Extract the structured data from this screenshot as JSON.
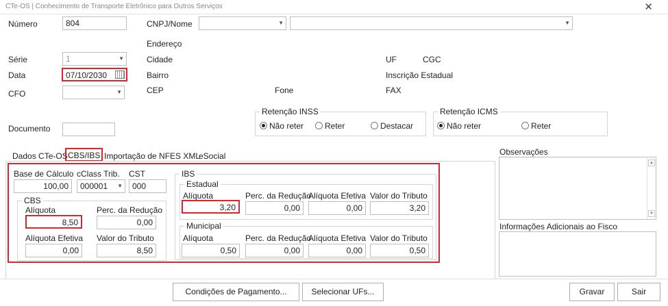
{
  "window": {
    "title": "CTe-OS | Conhecimento de Transporte Eletrônico para Outros Serviços",
    "close": "✕"
  },
  "header": {
    "numero_label": "Número",
    "numero_value": "804",
    "cnpj_label": "CNPJ/Nome",
    "endereco_label": "Endereço",
    "serie_label": "Série",
    "serie_value": "1",
    "cidade_label": "Cidade",
    "uf_label": "UF",
    "cgc_label": "CGC",
    "data_label": "Data",
    "data_value": "07/10/2030",
    "bairro_label": "Bairro",
    "ie_label": "Inscrição Estadual",
    "cfo_label": "CFO",
    "cep_label": "CEP",
    "fone_label": "Fone",
    "fax_label": "FAX",
    "documento_label": "Documento"
  },
  "retencao_inss": {
    "caption": "Retenção INSS",
    "options": [
      "Não reter",
      "Reter",
      "Destacar"
    ],
    "selected": "Não reter"
  },
  "retencao_icms": {
    "caption": "Retenção ICMS",
    "options": [
      "Não reter",
      "Reter"
    ],
    "selected": "Não reter"
  },
  "tabs": [
    {
      "label": "Dados CTe-OS",
      "active": false
    },
    {
      "label": "CBS/IBS",
      "active": true
    },
    {
      "label": "Importação de NFES XML",
      "active": false
    },
    {
      "label": "eSocial",
      "active": false
    }
  ],
  "cbs_ibs": {
    "base_calculo_label": "Base de Cálculo",
    "base_calculo_value": "100,00",
    "cclass_label": "cClass Trib.",
    "cclass_value": "000001",
    "cst_label": "CST",
    "cst_value": "000",
    "cbs": {
      "caption": "CBS",
      "aliquota_label": "Alíquota",
      "aliquota_value": "8,50",
      "perc_reducao_label": "Perc. da Redução",
      "perc_reducao_value": "0,00",
      "aliquota_efetiva_label": "Alíquota Efetiva",
      "aliquota_efetiva_value": "0,00",
      "valor_tributo_label": "Valor do Tributo",
      "valor_tributo_value": "8,50"
    },
    "ibs": {
      "caption": "IBS",
      "estadual": {
        "caption": "Estadual",
        "aliquota_label": "Alíquota",
        "aliquota_value": "3,20",
        "perc_reducao_label": "Perc. da Redução",
        "perc_reducao_value": "0,00",
        "aliquota_efetiva_label": "Alíquota Efetiva",
        "aliquota_efetiva_value": "0,00",
        "valor_tributo_label": "Valor do Tributo",
        "valor_tributo_value": "3,20"
      },
      "municipal": {
        "caption": "Municipal",
        "aliquota_label": "Alíquota",
        "aliquota_value": "0,50",
        "perc_reducao_label": "Perc. da Redução",
        "perc_reducao_value": "0,00",
        "aliquota_efetiva_label": "Alíquota Efetiva",
        "aliquota_efetiva_value": "0,00",
        "valor_tributo_label": "Valor do Tributo",
        "valor_tributo_value": "0,50"
      }
    }
  },
  "right_panel": {
    "observacoes_label": "Observações",
    "info_fisco_label": "Informações Adicionais ao Fisco"
  },
  "footer": {
    "condicoes_button": "Condições de Pagamento...",
    "selecionar_ufs_button": "Selecionar UFs...",
    "gravar_button": "Gravar",
    "sair_button": "Sair"
  },
  "colors": {
    "highlight": "#d9252f"
  },
  "icons": {
    "calendar": "calendar-icon",
    "dropdown": "chevron-down-icon",
    "close": "close-icon"
  }
}
